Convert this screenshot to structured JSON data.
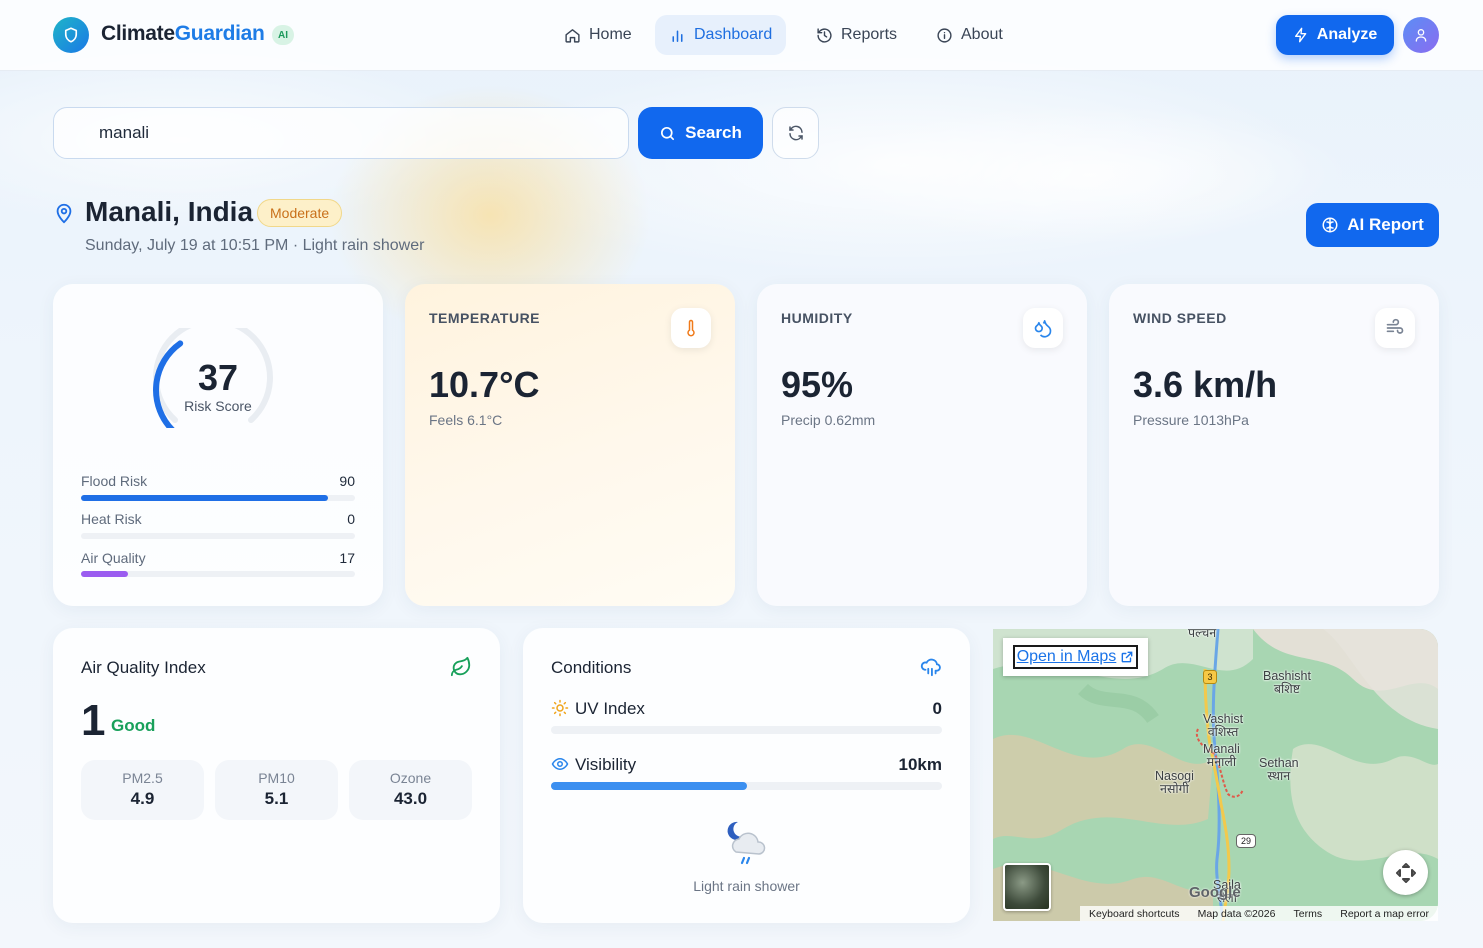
{
  "header": {
    "brand_part1": "Climate",
    "brand_part2": "Guardian",
    "ai_badge": "AI",
    "nav": [
      {
        "label": "Home"
      },
      {
        "label": "Dashboard"
      },
      {
        "label": "Reports"
      },
      {
        "label": "About"
      }
    ],
    "analyze_label": "Analyze"
  },
  "search": {
    "value": "manali",
    "button_label": "Search"
  },
  "location": {
    "title": "Manali, India",
    "badge": "Moderate",
    "subtitle": "Sunday, July 19 at 10:51 PM · Light rain shower",
    "ai_report_label": "AI Report"
  },
  "risk": {
    "score": "37",
    "score_label": "Risk Score",
    "score_fraction": 0.37,
    "rows": [
      {
        "label": "Flood Risk",
        "value": "90",
        "fraction": 0.9,
        "color": "#1f6fe6"
      },
      {
        "label": "Heat Risk",
        "value": "0",
        "fraction": 0.0,
        "color": "#f5953b"
      },
      {
        "label": "Air Quality",
        "value": "17",
        "fraction": 0.17,
        "color": "#9b5cf0"
      }
    ]
  },
  "stats": [
    {
      "label": "TEMPERATURE",
      "value": "10.7°C",
      "sub": "Feels 6.1°C",
      "icon": "thermometer-icon"
    },
    {
      "label": "HUMIDITY",
      "value": "95%",
      "sub": "Precip 0.62mm",
      "icon": "droplets-icon"
    },
    {
      "label": "WIND SPEED",
      "value": "3.6 km/h",
      "sub": "Pressure 1013hPa",
      "icon": "wind-icon"
    }
  ],
  "aqi": {
    "title": "Air Quality Index",
    "value": "1",
    "status": "Good",
    "pm": [
      {
        "label": "PM2.5",
        "value": "4.9"
      },
      {
        "label": "PM10",
        "value": "5.1"
      },
      {
        "label": "Ozone",
        "value": "43.0"
      }
    ]
  },
  "conditions": {
    "title": "Conditions",
    "uv_label": "UV Index",
    "uv_value": "0",
    "uv_fraction": 0.0,
    "visibility_label": "Visibility",
    "visibility_value": "10km",
    "visibility_fraction": 0.5,
    "weather_text": "Light rain shower"
  },
  "map": {
    "open_label": "Open in Maps",
    "places": [
      {
        "name": "पल्चन"
      },
      {
        "name": "Bashisht",
        "local": "बशिष्ट"
      },
      {
        "name": "Vashist",
        "local": "वशिस्त"
      },
      {
        "name": "Manali",
        "local": "मनाली"
      },
      {
        "name": "Sethan",
        "local": "स्थान"
      },
      {
        "name": "Nasogi",
        "local": "नसोगी"
      },
      {
        "name": "Saila",
        "local": "सैला"
      }
    ],
    "road_3": "3",
    "road_29": "29",
    "google": "Google",
    "footer": [
      "Keyboard shortcuts",
      "Map data ©2026",
      "Terms",
      "Report a map error"
    ]
  }
}
